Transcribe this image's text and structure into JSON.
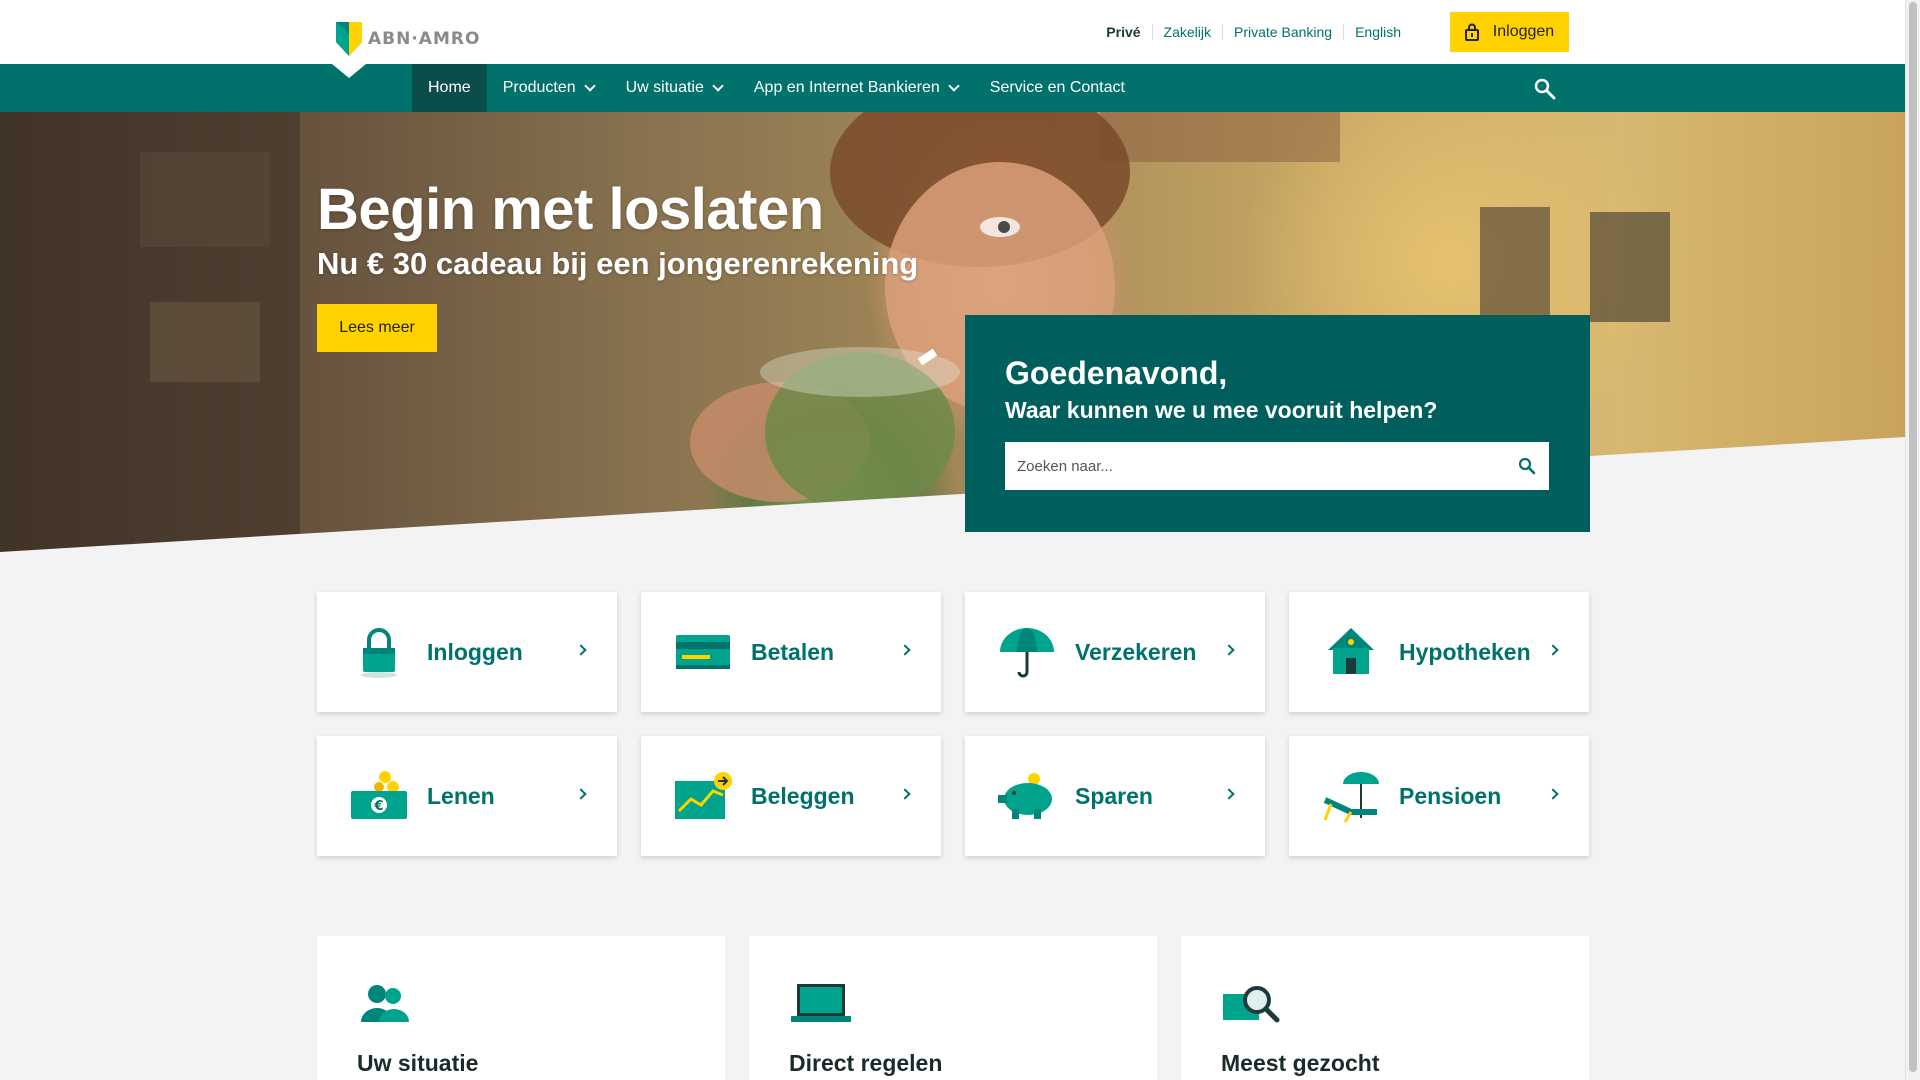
{
  "brand": {
    "logo_text": "ABN·AMRO"
  },
  "toplinks": [
    "Privé",
    "Zakelijk",
    "Private Banking",
    "English"
  ],
  "login_button": "Inloggen",
  "nav": {
    "items": [
      {
        "label": "Home"
      },
      {
        "label": "Producten"
      },
      {
        "label": "Uw situatie"
      },
      {
        "label": "App en Internet Bankieren"
      },
      {
        "label": "Service en Contact"
      }
    ]
  },
  "hero": {
    "title": "Begin met loslaten",
    "subtitle": "Nu € 30 cadeau bij een jongerenrekening",
    "button": "Lees meer"
  },
  "greeting": {
    "title": "Goedenavond,",
    "subtitle": "Waar kunnen we u mee vooruit helpen?",
    "search_placeholder": "Zoeken naar..."
  },
  "tiles": [
    {
      "label": "Inloggen",
      "icon": "padlock-icon"
    },
    {
      "label": "Betalen",
      "icon": "bank-card-icon"
    },
    {
      "label": "Verzekeren",
      "icon": "umbrella-icon"
    },
    {
      "label": "Hypotheken",
      "icon": "house-icon"
    },
    {
      "label": "Lenen",
      "icon": "euro-bill-coins-icon"
    },
    {
      "label": "Beleggen",
      "icon": "investment-chart-icon"
    },
    {
      "label": "Sparen",
      "icon": "piggy-bank-icon"
    },
    {
      "label": "Pensioen",
      "icon": "beach-chair-icon"
    }
  ],
  "cards": [
    {
      "title": "Uw situatie",
      "icon": "people-icon"
    },
    {
      "title": "Direct regelen",
      "icon": "laptop-icon"
    },
    {
      "title": "Meest gezocht",
      "icon": "magnifier-icon"
    }
  ],
  "colors": {
    "primary": "#00716b",
    "dark": "#005e5d",
    "accent": "#ffd200"
  }
}
